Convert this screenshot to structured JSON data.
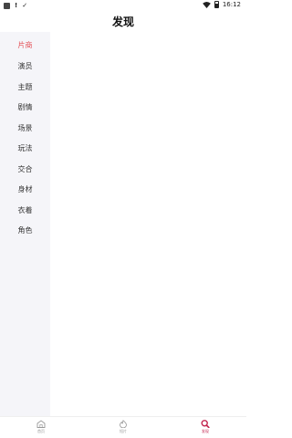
{
  "status_bar": {
    "time": "16:12"
  },
  "header": {
    "title": "发现"
  },
  "sidebar": {
    "items": [
      {
        "label": "片商",
        "active": true
      },
      {
        "label": "演员"
      },
      {
        "label": "主题"
      },
      {
        "label": "剧情"
      },
      {
        "label": "场景"
      },
      {
        "label": "玩法"
      },
      {
        "label": "交合"
      },
      {
        "label": "身材"
      },
      {
        "label": "衣着"
      },
      {
        "label": "角色"
      }
    ]
  },
  "bottom_nav": {
    "items": [
      {
        "label": "首页",
        "icon": "home-icon"
      },
      {
        "label": "短片",
        "icon": "flame-icon"
      },
      {
        "label": "发现",
        "icon": "search-icon",
        "active": true
      }
    ],
    "active_color": "#c3264f"
  },
  "colors": {
    "accent": "#e34f55",
    "sidebar_bg": "#f5f5f9"
  }
}
